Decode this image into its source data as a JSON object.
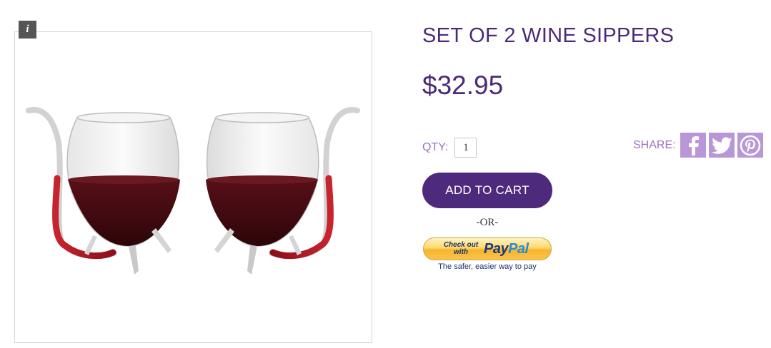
{
  "product": {
    "title": "SET OF 2 WINE SIPPERS",
    "price": "$32.95"
  },
  "image": {
    "info_icon_glyph": "i"
  },
  "purchase": {
    "qty_label": "QTY:",
    "qty_value": "1",
    "add_to_cart_label": "ADD TO CART",
    "or_label": "-OR-"
  },
  "share": {
    "label": "SHARE:",
    "icons": [
      "facebook-icon",
      "twitter-icon",
      "pinterest-icon"
    ],
    "icon_background": "#b996d6"
  },
  "paypal": {
    "checkout_text": "Check out with",
    "logo_pay": "Pay",
    "logo_pal": "Pal",
    "tagline": "The safer, easier way to pay"
  },
  "colors": {
    "title": "#4a2a7a",
    "label": "#9b72c0",
    "button": "#4e2a7d"
  }
}
